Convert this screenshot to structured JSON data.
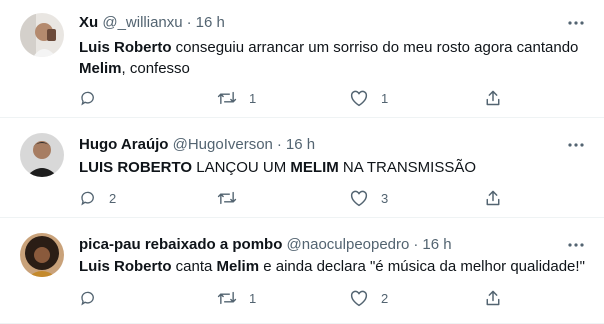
{
  "tweets": [
    {
      "name": "Xu",
      "handle": "@_willianxu",
      "separator": "·",
      "time": "16 h",
      "text_parts": [
        {
          "t": "Luis Roberto",
          "b": true
        },
        {
          "t": " conseguiu arrancar um sorriso do meu rosto agora cantando",
          "b": false
        },
        {
          "t": "Melim",
          "b": true
        },
        {
          "t": ", confesso",
          "b": false
        }
      ],
      "reply_count": "",
      "retweet_count": "1",
      "like_count": "1"
    },
    {
      "name": "Hugo Araújo",
      "handle": "@HugoIverson",
      "separator": "·",
      "time": "16 h",
      "text_parts": [
        {
          "t": "LUIS ROBERTO",
          "b": true
        },
        {
          "t": " LANÇOU UM ",
          "b": false
        },
        {
          "t": "MELIM",
          "b": true
        },
        {
          "t": " NA TRANSMISSÃO",
          "b": false
        }
      ],
      "reply_count": "2",
      "retweet_count": "",
      "like_count": "3"
    },
    {
      "name": "pica-pau rebaixado a pombo",
      "handle": "@naoculpeopedro",
      "separator": "·",
      "time": "16 h",
      "text_parts": [
        {
          "t": "Luis Roberto",
          "b": true
        },
        {
          "t": " canta ",
          "b": false
        },
        {
          "t": "Melim",
          "b": true
        },
        {
          "t": " e ainda declara \"é música da melhor qualidade!\"",
          "b": false
        }
      ],
      "reply_count": "",
      "retweet_count": "1",
      "like_count": "2"
    }
  ],
  "icons": {
    "more": "more-icon",
    "reply": "reply-icon",
    "retweet": "retweet-icon",
    "like": "like-icon",
    "share": "share-icon"
  },
  "colors": {
    "text": "#0f1419",
    "secondary": "#536471",
    "divider": "#eff3f4"
  }
}
